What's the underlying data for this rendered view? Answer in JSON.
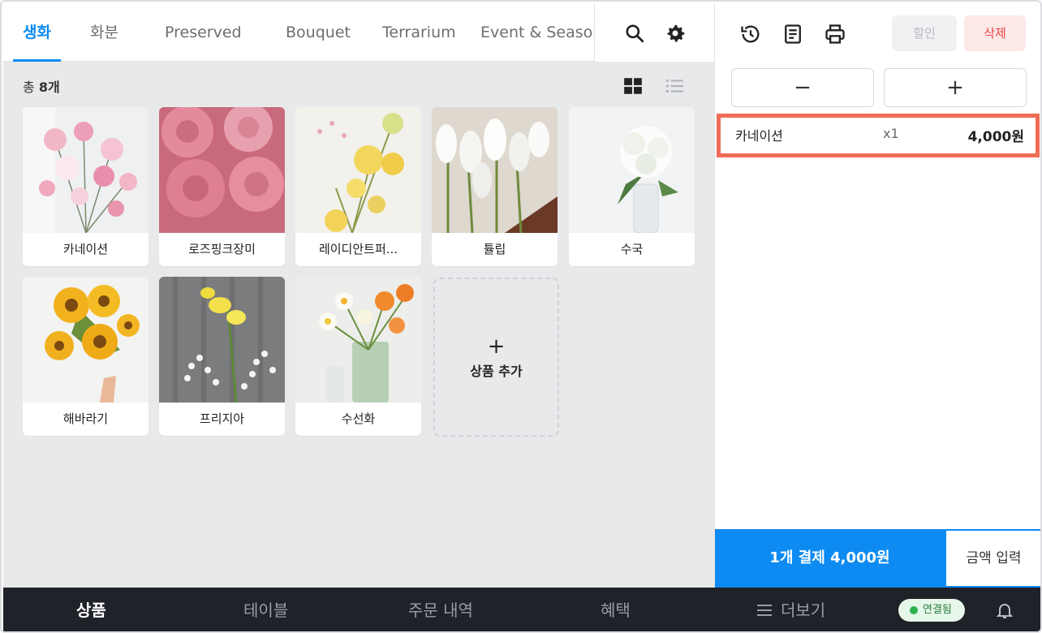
{
  "tabs": [
    {
      "label": "생화",
      "active": true
    },
    {
      "label": "화분",
      "active": false
    },
    {
      "label": "Preserved",
      "active": false
    },
    {
      "label": "Bouquet",
      "active": false
    },
    {
      "label": "Terrarium",
      "active": false
    },
    {
      "label": "Event & Season",
      "active": false
    }
  ],
  "toolbar": {
    "search_icon": "search-icon",
    "settings_icon": "gear-icon"
  },
  "product_count": {
    "prefix": "총 ",
    "value": "8개"
  },
  "view_modes": {
    "grid_icon": "grid-icon",
    "list_icon": "list-icon",
    "active": "grid"
  },
  "products": [
    {
      "name": "카네이션",
      "image": "pink carnations"
    },
    {
      "name": "로즈핑크장미",
      "image": "pink roses"
    },
    {
      "name": "레이디안트퍼...",
      "image": "yellow roses"
    },
    {
      "name": "튤립",
      "image": "white tulips"
    },
    {
      "name": "수국",
      "image": "white hydrangea"
    },
    {
      "name": "해바라기",
      "image": "sunflowers"
    },
    {
      "name": "프리지아",
      "image": "yellow freesia"
    },
    {
      "name": "수선화",
      "image": "daffodils"
    }
  ],
  "add_product": {
    "plus": "+",
    "label": "상품 추가"
  },
  "order_panel": {
    "icons": [
      "history-icon",
      "receipt-icon",
      "printer-icon"
    ],
    "discount_label": "할인",
    "delete_label": "삭제",
    "minus_label": "−",
    "plus_label": "+",
    "items": [
      {
        "name": "카네이션",
        "qty": "x1",
        "price": "4,000원"
      }
    ],
    "pay_button": "1개 결제  4,000원",
    "amount_input_button": "금액 입력"
  },
  "bottom_nav": {
    "items": [
      "상품",
      "테이블",
      "주문 내역",
      "혜택",
      "더보기"
    ],
    "active": "상품",
    "connection_status": "연결됨",
    "bell_icon": "bell-icon"
  },
  "colors": {
    "accent": "#0d8bf2",
    "highlight": "#ef6c56",
    "danger": "#e84545",
    "nav_bg": "#1f2229"
  }
}
